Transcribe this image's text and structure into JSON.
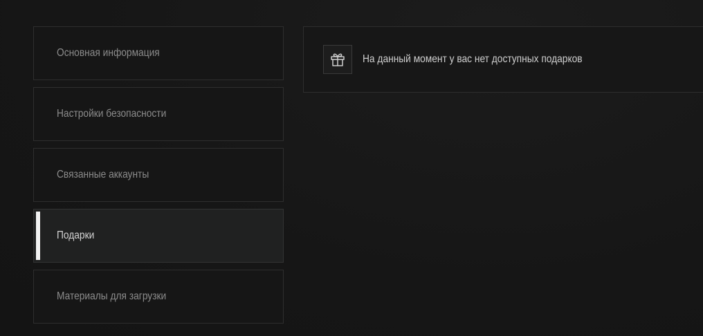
{
  "sidebar": {
    "items": [
      {
        "label": "Основная информация",
        "active": false
      },
      {
        "label": "Настройки безопасности",
        "active": false
      },
      {
        "label": "Связанные аккаунты",
        "active": false
      },
      {
        "label": "Подарки",
        "active": true
      },
      {
        "label": "Материалы для загрузки",
        "active": false
      }
    ]
  },
  "main": {
    "gifts_empty_message": "На данный момент у вас нет доступных подарков",
    "icon": "gift-icon"
  },
  "colors": {
    "background": "#171717",
    "active_indicator": "#f2f2f2",
    "border": "#2e2e2e"
  }
}
